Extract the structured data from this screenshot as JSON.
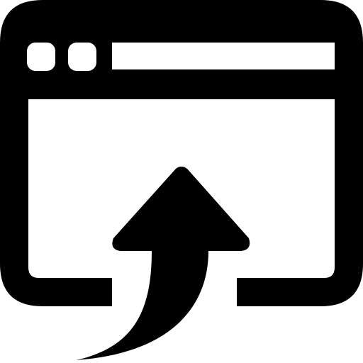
{
  "icon": {
    "name": "browser-upload-icon",
    "parts": [
      "browser-window-icon",
      "window-dot-icon",
      "address-bar",
      "upload-arrow-icon"
    ]
  },
  "colors": {
    "foreground": "#000000",
    "background": "#ffffff"
  }
}
